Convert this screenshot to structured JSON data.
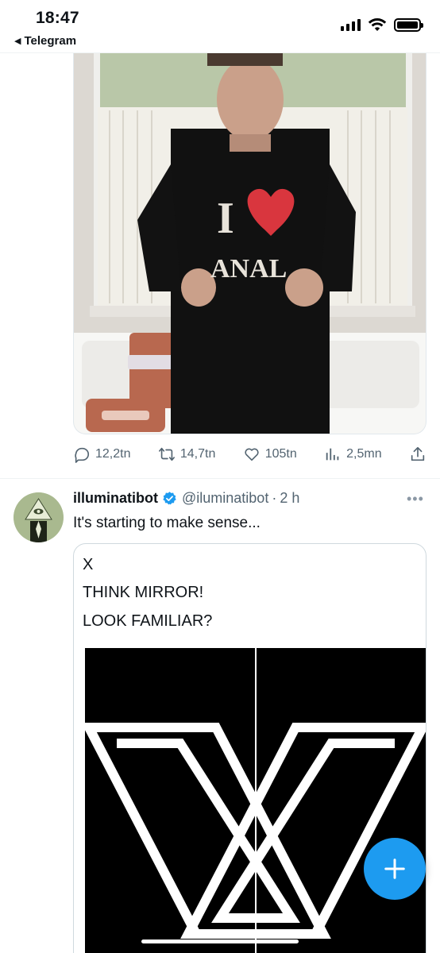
{
  "status_bar": {
    "time": "18:47",
    "back_app": "Telegram"
  },
  "tweet1": {
    "media_icon": "photo",
    "shirt_text": "ANAL",
    "actions": {
      "replies": "12,2tn",
      "retweets": "14,7tn",
      "likes": "105tn",
      "views": "2,5mn"
    }
  },
  "tweet2": {
    "display_name": "illuminatibot",
    "verified": true,
    "handle": "@iluminatibot",
    "separator": "·",
    "time": "2 h",
    "text": "It's starting to make sense...",
    "quote": {
      "line1": "X",
      "line2": "THINK MIRROR!",
      "line3": "LOOK FAMILIAR?"
    }
  },
  "colors": {
    "accent": "#1d9bf0",
    "muted": "#536471",
    "verified": "#1d9bf0"
  }
}
